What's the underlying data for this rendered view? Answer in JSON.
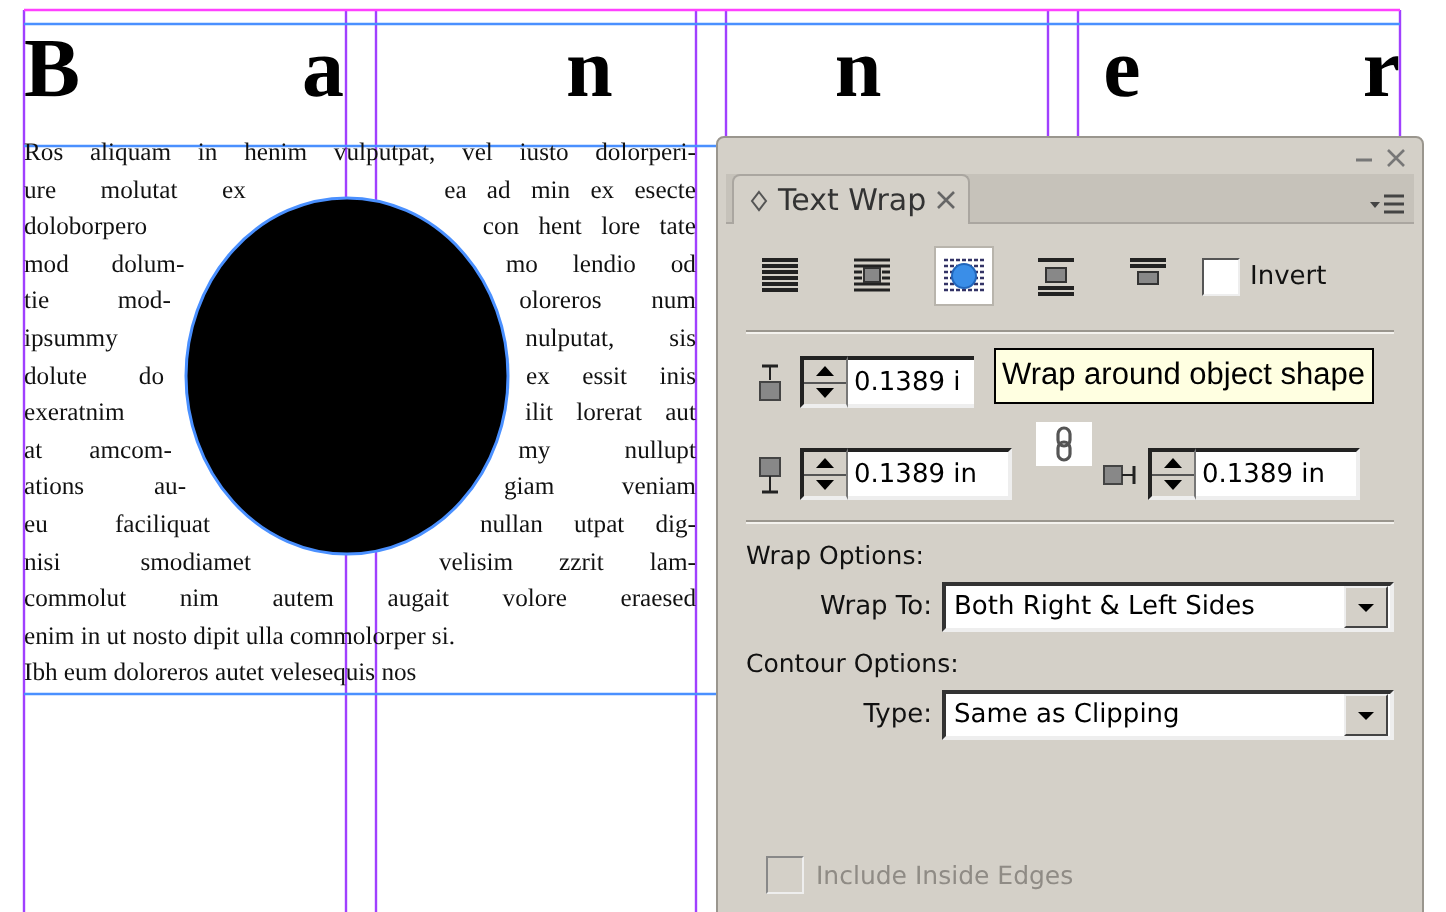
{
  "banner": "B a n n e r",
  "story": {
    "lines": [
      {
        "kind": "full",
        "text": "Ros aliquam in henim vulputpat, vel iusto dolorperi-"
      },
      {
        "kind": "split",
        "left": "ure molutat ex",
        "right": "ea ad min ex esecte"
      },
      {
        "kind": "split",
        "left": "doloborpero",
        "right": "con hent lore tate"
      },
      {
        "kind": "split",
        "left": "mod dolum-",
        "right": "mo lendio od"
      },
      {
        "kind": "split",
        "left": "tie mod-",
        "right": "oloreros num"
      },
      {
        "kind": "split",
        "left": "ipsummy",
        "right": "nulputat, sis"
      },
      {
        "kind": "split",
        "left": "dolute do",
        "right": "ex essit inis"
      },
      {
        "kind": "split",
        "left": "exeratnim",
        "right": "ilit lorerat aut"
      },
      {
        "kind": "split",
        "left": "at amcom-",
        "right": "my nullupt"
      },
      {
        "kind": "split",
        "left": "ations au-",
        "right": "giam veniam"
      },
      {
        "kind": "split",
        "left": "eu faciliquat",
        "right": "nullan utpat dig-"
      },
      {
        "kind": "split",
        "left": "nisi smodiamet",
        "right": "velisim zzrit lam-"
      },
      {
        "kind": "full",
        "text": "commolut nim autem augait volore eraesed"
      },
      {
        "kind": "end",
        "text": "enim in ut nosto dipit ulla commolorper si."
      },
      {
        "kind": "end",
        "text": "Ibh eum doloreros autet velesequis nos"
      }
    ]
  },
  "panel": {
    "tab": {
      "label": "Text Wrap",
      "selected": true
    },
    "wrap_modes": [
      {
        "kind": "none",
        "selected": false
      },
      {
        "kind": "bounding_box",
        "selected": false
      },
      {
        "kind": "object_shape",
        "selected": true
      },
      {
        "kind": "jump_object",
        "selected": false
      },
      {
        "kind": "next_column",
        "selected": false
      }
    ],
    "invert": {
      "label": "Invert",
      "checked": false
    },
    "offsets": [
      {
        "kind": "top",
        "value": "0.1389 i"
      },
      {
        "kind": "bottom",
        "value": "0.1389 in"
      },
      {
        "kind": "right",
        "value": "0.1389 in"
      }
    ],
    "tooltip": "Wrap around object shape",
    "wrap_options": {
      "heading": "Wrap Options:",
      "label": "Wrap To:",
      "value": "Both Right & Left Sides"
    },
    "contour_options": {
      "heading": "Contour Options:",
      "label": "Type:",
      "value": "Same as Clipping"
    },
    "include_inside_edges": {
      "label": "Include Inside Edges",
      "checked": false,
      "disabled": true
    }
  }
}
